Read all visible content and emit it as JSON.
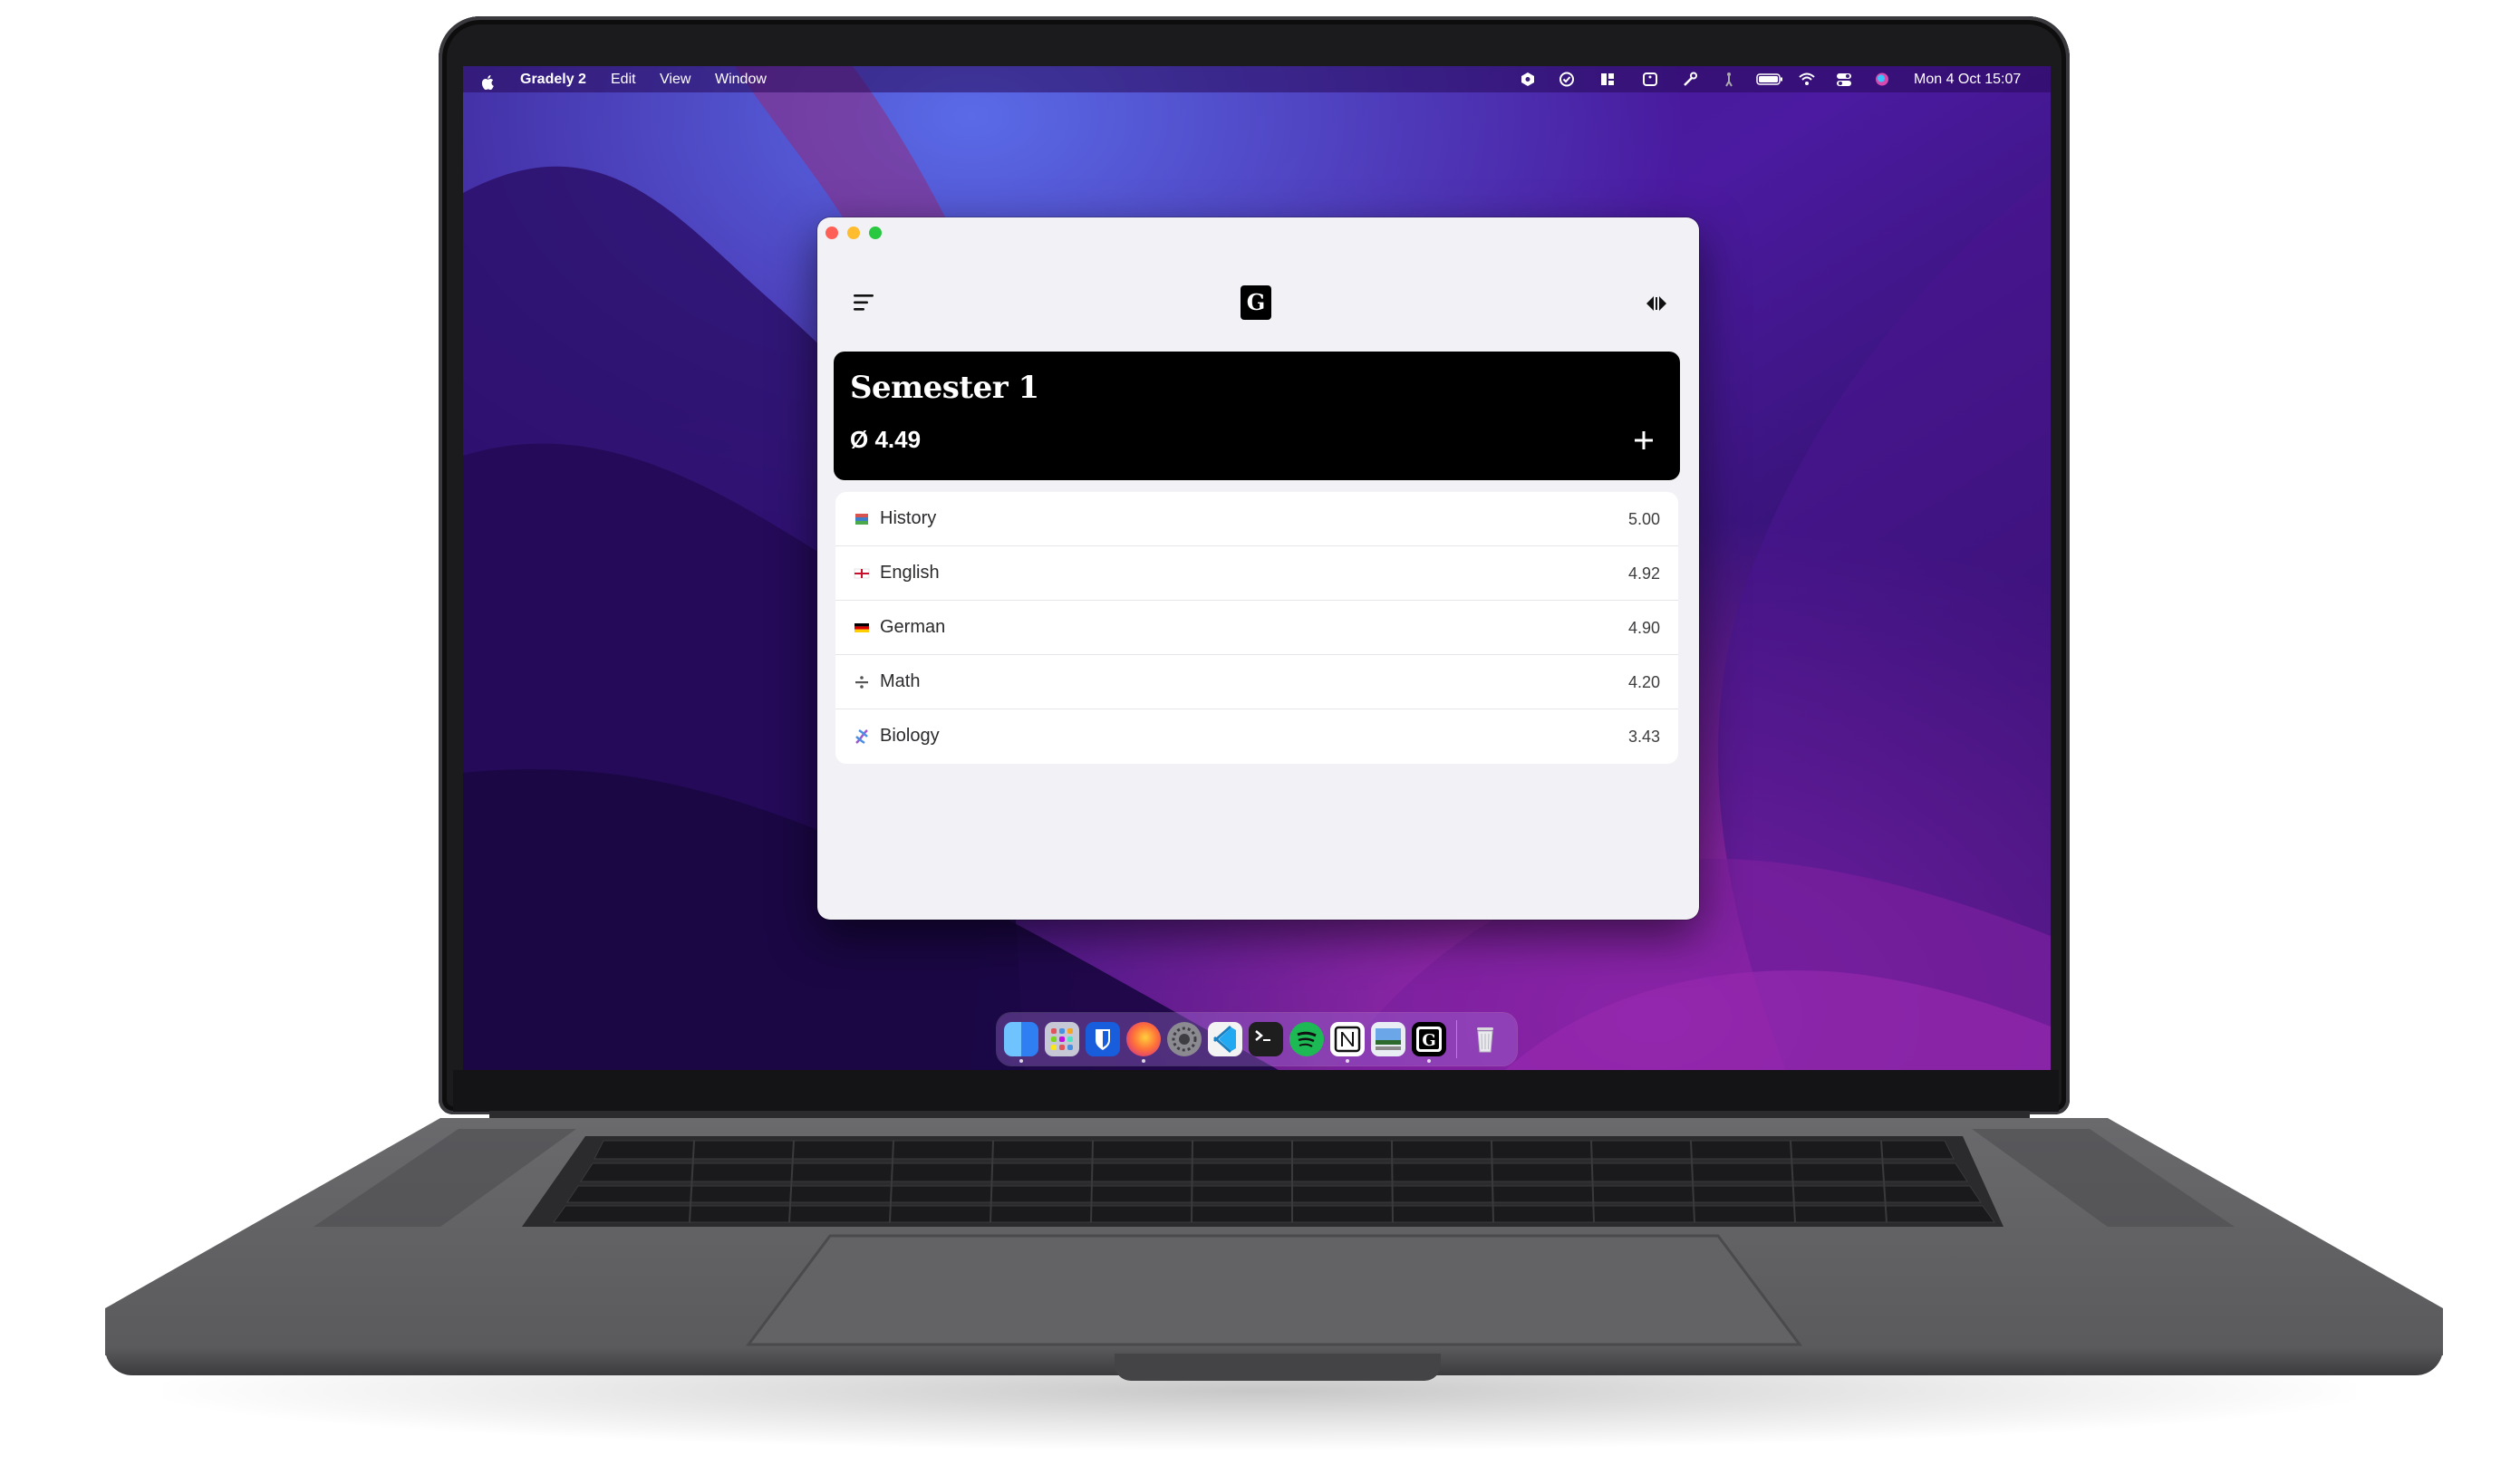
{
  "menubar": {
    "apple_icon": "apple-logo-icon",
    "app_name": "Gradely 2",
    "menus": [
      "Edit",
      "View",
      "Window"
    ],
    "status_icons": [
      "shield-icon",
      "check-circle-icon",
      "widgets-icon",
      "sidebar-icon",
      "tools-icon",
      "accessibility-icon",
      "battery-icon",
      "wifi-icon",
      "control-center-icon",
      "siri-icon"
    ],
    "datetime": "Mon 4 Oct  15:07"
  },
  "window": {
    "toolbar": {
      "menu_icon": "hamburger-menu-icon",
      "logo_letter": "G",
      "nav_icon": "previous-next-arrows-icon"
    },
    "semester": {
      "title": "Semester 1",
      "average": "Ø 4.49",
      "add_icon": "plus-icon"
    },
    "subjects": [
      {
        "emoji": "books-icon",
        "name": "History",
        "grade": "5.00"
      },
      {
        "emoji": "uk-flag-icon",
        "name": "English",
        "grade": "4.92"
      },
      {
        "emoji": "german-flag-icon",
        "name": "German",
        "grade": "4.90"
      },
      {
        "emoji": "divide-icon",
        "name": "Math",
        "grade": "4.20"
      },
      {
        "emoji": "dna-icon",
        "name": "Biology",
        "grade": "3.43"
      }
    ]
  },
  "dock": {
    "apps": [
      "finder-icon",
      "launchpad-icon",
      "bitwarden-icon",
      "firefox-icon",
      "system-preferences-icon",
      "vscode-icon",
      "terminal-icon",
      "spotify-icon",
      "notion-icon",
      "preview-icon",
      "gradely-icon",
      "trash-icon"
    ],
    "colors": {
      "finder": "#3a8ef6",
      "bitwarden": "#175ddc",
      "firefox": "#ff7139",
      "vscode": "#23a9f2",
      "spotify": "#1db954"
    }
  },
  "colors": {
    "wallpaper_primary": "#5b1fa8",
    "card_bg": "#000000",
    "window_bg": "#f2f2f6"
  }
}
